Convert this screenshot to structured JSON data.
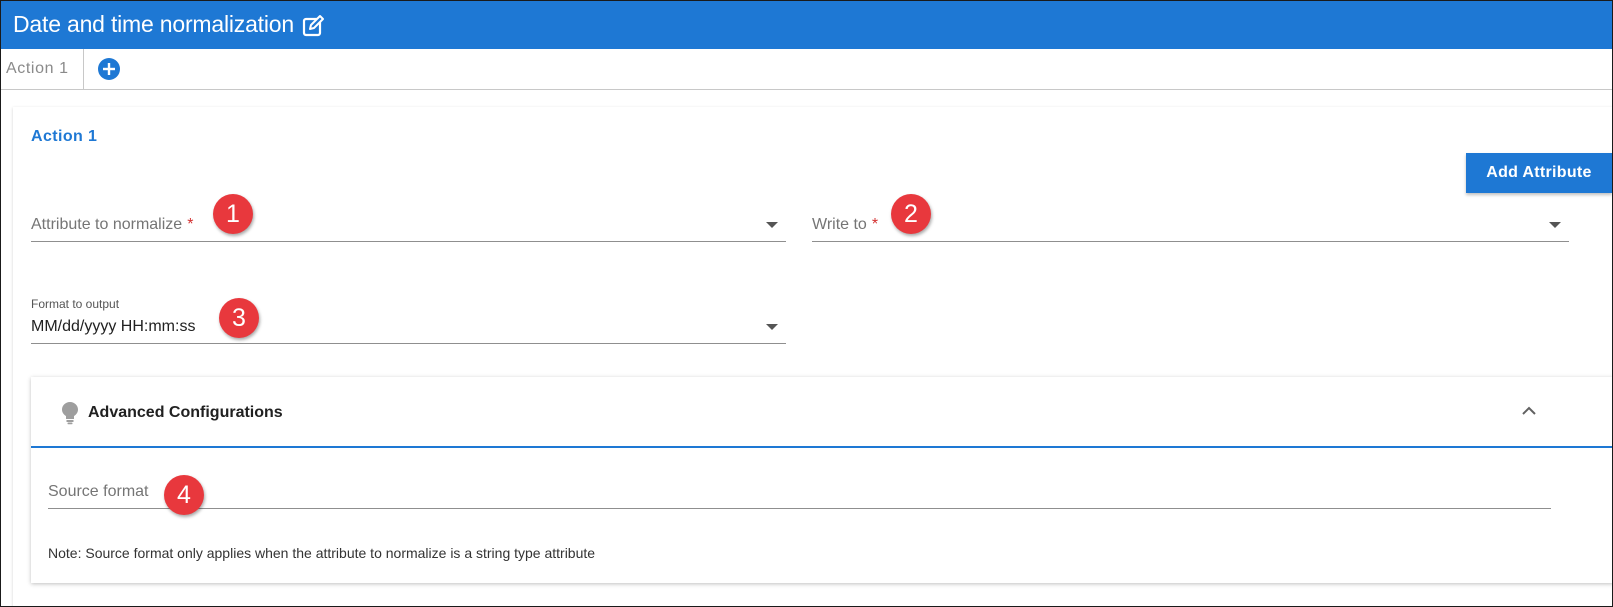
{
  "window": {
    "title": "Date and time normalization"
  },
  "tabs": [
    {
      "label": "Action 1"
    }
  ],
  "action": {
    "title": "Action 1",
    "add_attribute_label": "Add Attribute",
    "attribute_field": {
      "label": "Attribute to normalize",
      "required_mark": "*",
      "value": ""
    },
    "write_to_field": {
      "label": "Write to",
      "required_mark": "*",
      "value": ""
    },
    "format_field": {
      "label": "Format to output",
      "value": "MM/dd/yyyy HH:mm:ss"
    }
  },
  "advanced": {
    "title": "Advanced Configurations",
    "source_format": {
      "label": "Source format",
      "value": ""
    },
    "note": "Note: Source format only applies when the attribute to normalize is a string type attribute"
  },
  "markers": [
    "1",
    "2",
    "3",
    "4"
  ],
  "colors": {
    "primary": "#1e78d4",
    "required": "#d32f2f",
    "marker": "#e8383d"
  },
  "icons": [
    "edit-icon",
    "plus-circle-icon",
    "dropdown-arrow-icon",
    "lightbulb-icon",
    "chevron-up-icon"
  ]
}
